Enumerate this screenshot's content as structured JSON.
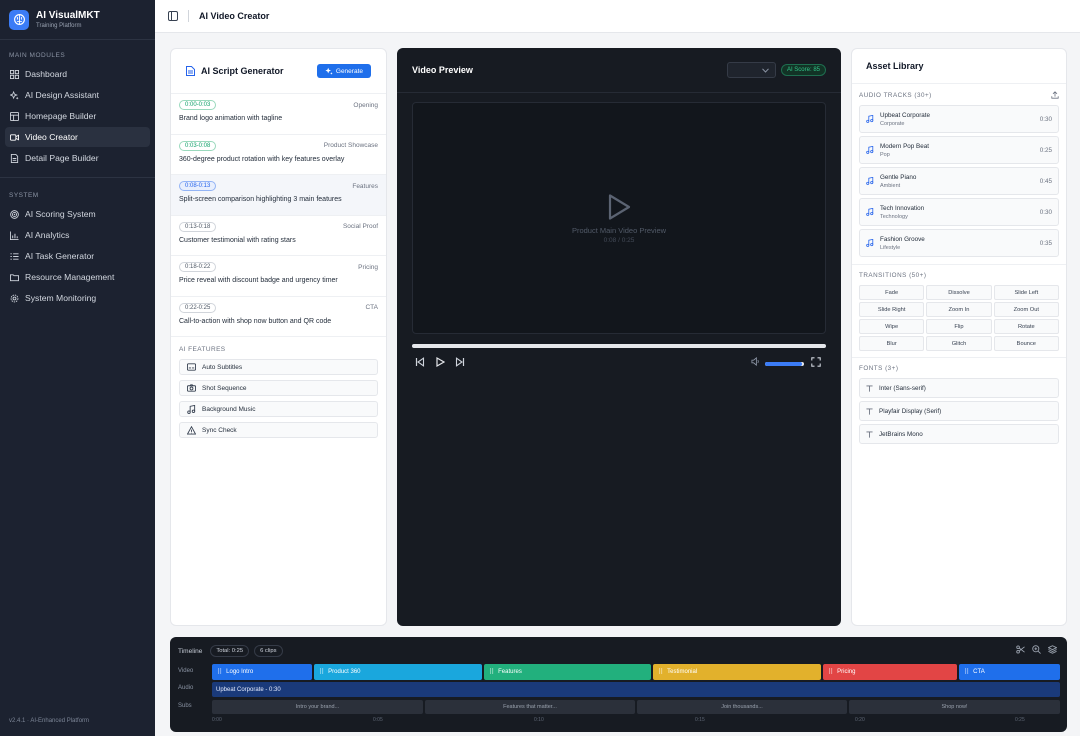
{
  "brand": {
    "name": "AI VisualMKT",
    "subtitle": "Training Platform"
  },
  "sidebar": {
    "main_label": "MAIN MODULES",
    "main_items": [
      {
        "label": "Dashboard",
        "icon": "grid-icon"
      },
      {
        "label": "AI Design Assistant",
        "icon": "sparkles-icon"
      },
      {
        "label": "Homepage Builder",
        "icon": "layout-icon"
      },
      {
        "label": "Video Creator",
        "icon": "video-icon",
        "active": true
      },
      {
        "label": "Detail Page Builder",
        "icon": "document-icon"
      }
    ],
    "system_label": "SYSTEM",
    "system_items": [
      {
        "label": "AI Scoring System",
        "icon": "target-icon"
      },
      {
        "label": "AI Analytics",
        "icon": "chart-icon"
      },
      {
        "label": "AI Task Generator",
        "icon": "list-icon"
      },
      {
        "label": "Resource Management",
        "icon": "folder-icon"
      },
      {
        "label": "System Monitoring",
        "icon": "gear-icon"
      }
    ],
    "footer": "v2.4.1 · AI-Enhanced Platform"
  },
  "header": {
    "title": "AI Video Creator"
  },
  "script": {
    "title": "AI Script Generator",
    "generate_label": "Generate",
    "segments": [
      {
        "time": "0:00-0:03",
        "type": "Opening",
        "desc": "Brand logo animation with tagline",
        "style": "green"
      },
      {
        "time": "0:03-0:08",
        "type": "Product Showcase",
        "desc": "360-degree product rotation with key features overlay",
        "style": "green"
      },
      {
        "time": "0:08-0:13",
        "type": "Features",
        "desc": "Split-screen comparison highlighting 3 main features",
        "style": "blue"
      },
      {
        "time": "0:13-0:18",
        "type": "Social Proof",
        "desc": "Customer testimonial with rating stars",
        "style": "gray"
      },
      {
        "time": "0:18-0:22",
        "type": "Pricing",
        "desc": "Price reveal with discount badge and urgency timer",
        "style": "gray"
      },
      {
        "time": "0:22-0:25",
        "type": "CTA",
        "desc": "Call-to-action with shop now button and QR code",
        "style": "gray"
      }
    ],
    "features_label": "AI FEATURES",
    "features": [
      {
        "label": "Auto Subtitles"
      },
      {
        "label": "Shot Sequence"
      },
      {
        "label": "Background Music"
      },
      {
        "label": "Sync Check"
      }
    ]
  },
  "video": {
    "title": "Video Preview",
    "score": "AI Score: 85",
    "placeholder": "Product Main Video Preview",
    "time": "0:08 / 0:25",
    "volume": 0.95
  },
  "assets": {
    "title": "Asset Library",
    "audio_label": "AUDIO TRACKS (30+)",
    "tracks": [
      {
        "name": "Upbeat Corporate",
        "genre": "Corporate",
        "duration": "0:30"
      },
      {
        "name": "Modern Pop Beat",
        "genre": "Pop",
        "duration": "0:25"
      },
      {
        "name": "Gentle Piano",
        "genre": "Ambient",
        "duration": "0:45"
      },
      {
        "name": "Tech Innovation",
        "genre": "Technology",
        "duration": "0:30"
      },
      {
        "name": "Fashion Groove",
        "genre": "Lifestyle",
        "duration": "0:35"
      }
    ],
    "transitions_label": "TRANSITIONS (50+)",
    "transitions": [
      "Fade",
      "Dissolve",
      "Slide Left",
      "Slide Right",
      "Zoom In",
      "Zoom Out",
      "Wipe",
      "Flip",
      "Rotate",
      "Blur",
      "Glitch",
      "Bounce"
    ],
    "fonts_label": "FONTS (3+)",
    "fonts": [
      "Inter (Sans-serif)",
      "Playfair Display (Serif)",
      "JetBrains Mono"
    ]
  },
  "timeline": {
    "title": "Timeline",
    "total": "Total: 0:25",
    "clip_count": "6 clips",
    "row_labels": {
      "video": "Video",
      "audio": "Audio",
      "subs": "Subs"
    },
    "video_clips": [
      {
        "label": "Logo Intro",
        "color": "#1f6feb"
      },
      {
        "label": "Product 360",
        "color": "#1aa7dd"
      },
      {
        "label": "Features",
        "color": "#22b07d"
      },
      {
        "label": "Testimonial",
        "color": "#e2b12c"
      },
      {
        "label": "Pricing",
        "color": "#e24545"
      },
      {
        "label": "CTA",
        "color": "#1f6feb"
      }
    ],
    "audio_clip": "Upbeat Corporate - 0:30",
    "subtitles": [
      "Intro your brand...",
      "Features that matter...",
      "Join thousands...",
      "Shop now!"
    ],
    "ticks": [
      "0:00",
      "0:05",
      "0:10",
      "0:15",
      "0:20",
      "0:25"
    ]
  }
}
